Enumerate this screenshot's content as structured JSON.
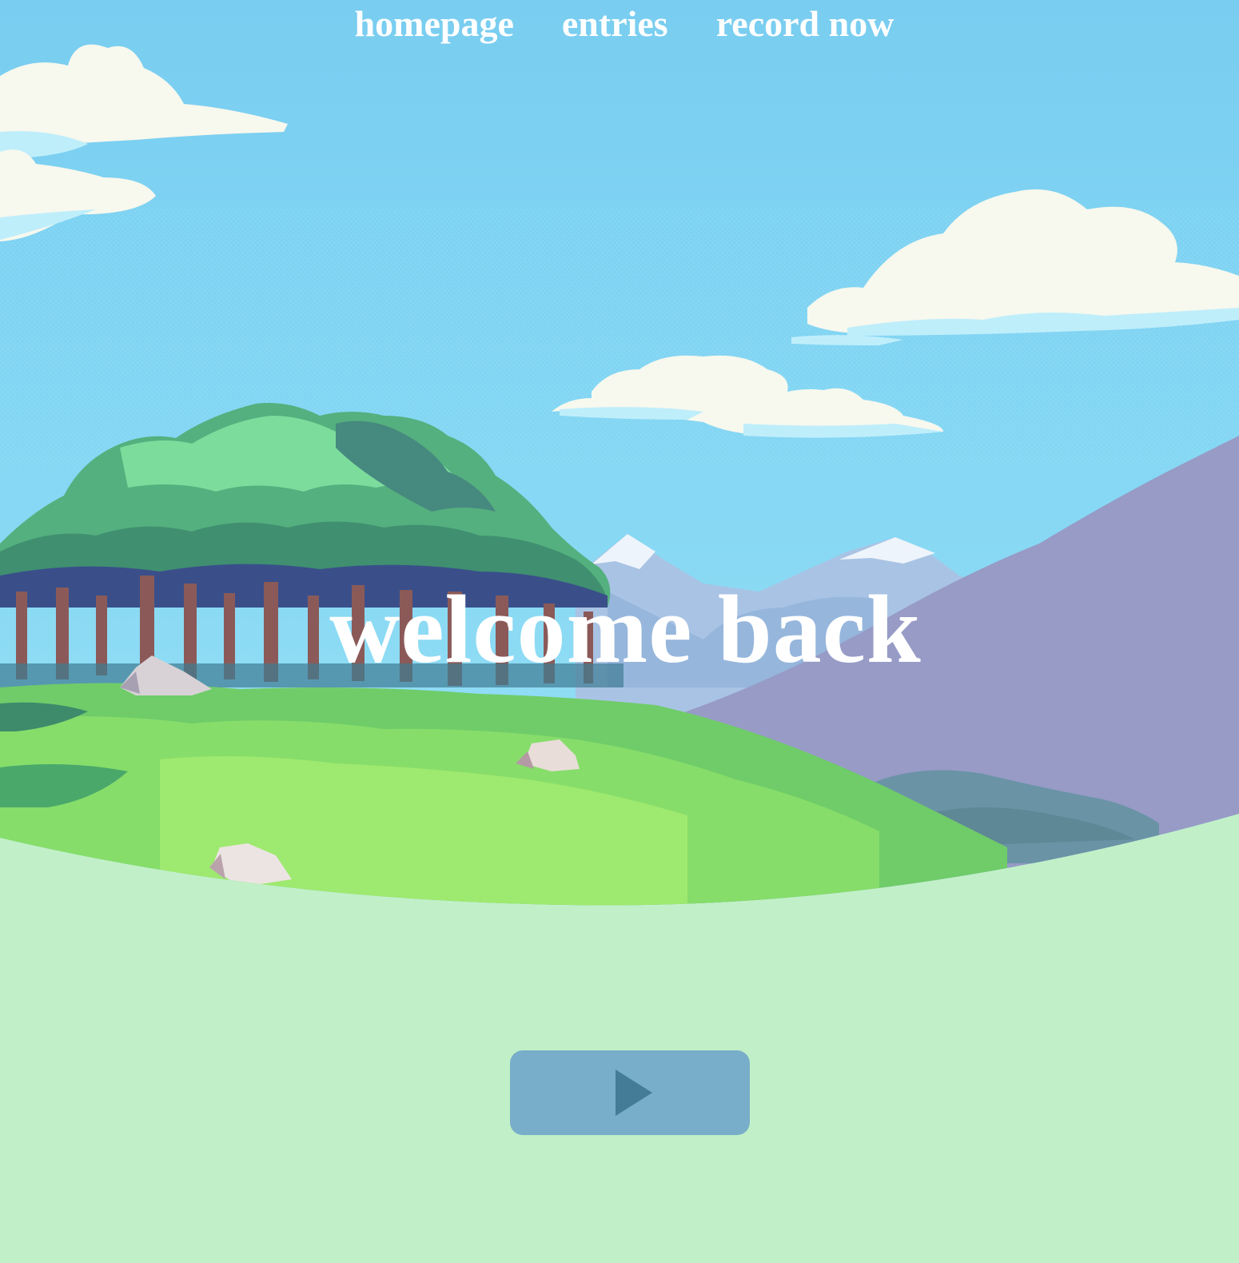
{
  "nav": {
    "items": [
      {
        "label": "homepage"
      },
      {
        "label": "entries"
      },
      {
        "label": "record now"
      }
    ]
  },
  "hero": {
    "title": "welcome back"
  },
  "player": {
    "icon": "play-icon"
  },
  "colors": {
    "sky": "#79cdf0",
    "ground": "#c1f0c8",
    "button": "#78aec9",
    "button_icon": "#447b96",
    "text": "#ffffff"
  }
}
